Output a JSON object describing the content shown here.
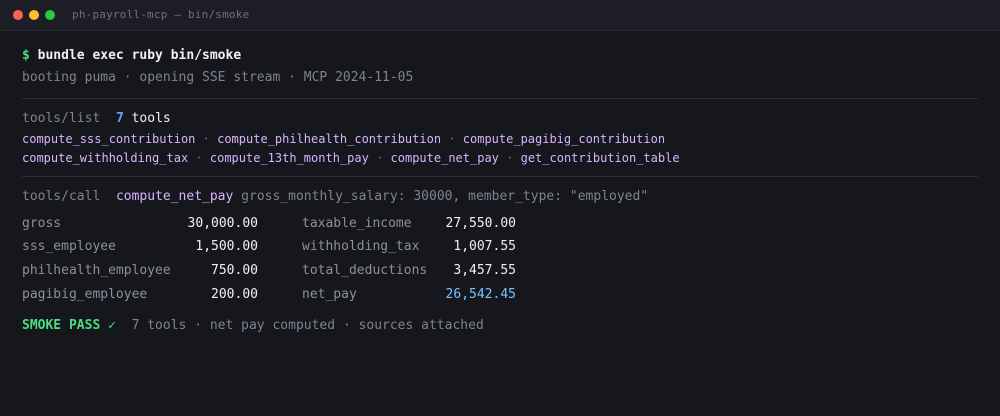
{
  "window": {
    "title": "ph-payroll-mcp — bin/smoke",
    "controls": [
      "close",
      "minimize",
      "zoom"
    ]
  },
  "terminal": {
    "prompt_symbol": "$",
    "command": "bundle exec ruby bin/smoke",
    "boot_message": "booting puma · opening SSE stream · MCP 2024-11-05",
    "tools_list": {
      "label": "tools/list",
      "count": "7",
      "count_suffix": "tools",
      "rows": [
        [
          "compute_sss_contribution",
          "compute_philhealth_contribution",
          "compute_pagibig_contribution"
        ],
        [
          "compute_withholding_tax",
          "compute_13th_month_pay",
          "compute_net_pay",
          "get_contribution_table"
        ]
      ],
      "separator": "·"
    },
    "tools_call": {
      "label": "tools/call",
      "tool": "compute_net_pay",
      "args": "gross_monthly_salary: 30000, member_type: \"employed\""
    },
    "results": {
      "left": [
        {
          "key": "gross",
          "value": "30,000.00"
        },
        {
          "key": "sss_employee",
          "value": "1,500.00"
        },
        {
          "key": "philhealth_employee",
          "value": "750.00"
        },
        {
          "key": "pagibig_employee",
          "value": "200.00"
        }
      ],
      "right": [
        {
          "key": "taxable_income",
          "value": "27,550.00"
        },
        {
          "key": "withholding_tax",
          "value": "1,007.55"
        },
        {
          "key": "total_deductions",
          "value": "3,457.55"
        },
        {
          "key": "net_pay",
          "value": "26,542.45",
          "highlight": true
        }
      ]
    },
    "status": {
      "label": "SMOKE PASS ✓",
      "message": "7 tools · net pay computed · sources attached"
    }
  },
  "colors": {
    "background": "#16171d",
    "prompt_green": "#4ade80",
    "tool_purple": "#d8b4fe",
    "count_blue": "#60a5fa",
    "net_pay_blue": "#7cc3ff",
    "muted_gray": "#7f838f"
  }
}
